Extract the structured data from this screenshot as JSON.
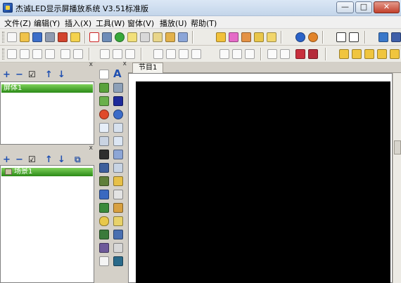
{
  "window": {
    "title": "杰诚LED显示屏播放系统 V3.51标准版",
    "min_glyph": "—",
    "max_glyph": "□",
    "close_glyph": "✕"
  },
  "menu": [
    "文件(Z)",
    "编辑(Y)",
    "插入(X)",
    "工具(W)",
    "窗体(V)",
    "播放(U)",
    "帮助(T)"
  ],
  "screen_panel": {
    "tools": {
      "add": "+",
      "remove": "−",
      "check": "☑",
      "up": "↑",
      "down": "↓"
    },
    "items": [
      "屏体1"
    ]
  },
  "scene_panel": {
    "tools": {
      "add": "+",
      "remove": "−",
      "check": "☑",
      "up": "↑",
      "down": "↓",
      "copy": "⧉"
    },
    "items": [
      "场景1"
    ]
  },
  "panel_close_glyph": "x",
  "program_tab": "节目1",
  "palette_text_tool": "A",
  "colors": {
    "canvas": "#000000",
    "selection_green": "#2b8a17",
    "toolbar_bg": "#ecebe6"
  }
}
